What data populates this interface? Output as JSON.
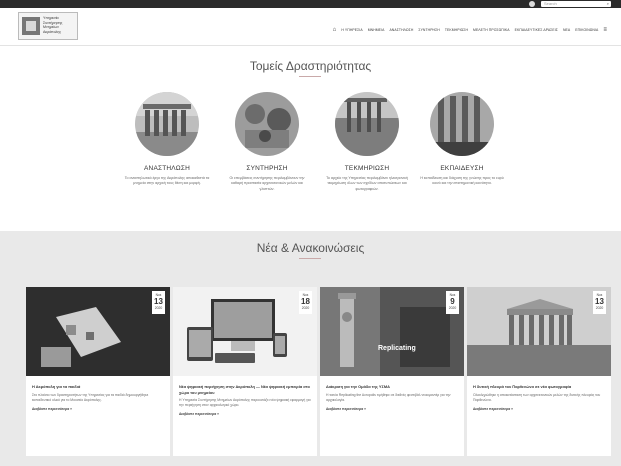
{
  "header": {
    "logo_lines": [
      "Υπηρεσία",
      "Συντήρησης",
      "Μνημείων",
      "Ακρόπολης"
    ],
    "search_placeholder": "Search",
    "nav": [
      "Η ΥΠΗΡΕΣΙΑ",
      "ΜΝΗΜΕΙΑ",
      "ΑΝΑΣΤΗΛΩΣΗ",
      "ΣΥΝΤΗΡΗΣΗ",
      "ΤΕΚΜΗΡΙΩΣΗ",
      "ΜΕΛΕΤΗ ΠΡΟΣΩΠΙΚΑ",
      "ΕΚΠΑΙΔΕΥΤΙΚΕΣ ΔΡΑΣΕΙΣ",
      "ΝΕΑ",
      "ΕΠΙΚΟΙΝΩΝΙΑ"
    ]
  },
  "activities": {
    "title": "Τομείς Δραστηριότητας",
    "items": [
      {
        "title": "ΑΝΑΣΤΗΛΩΣΗ",
        "text": "Το αναστηλωτικό έργο της Ακρόπολης αποκαθιστά τα μνημεία στην αρχική τους θέση και μορφή."
      },
      {
        "title": "ΣΥΝΤΗΡΗΣΗ",
        "text": "Οι επεμβάσεις συντήρησης περιλαμβάνουν την καθαρή προστασία αρχιτεκτονικών μελών και γλυπτών."
      },
      {
        "title": "ΤΕΚΜΗΡΙΩΣΗ",
        "text": "Το αρχείο της Υπηρεσίας περιλαμβάνει ηλεκτρονική τεκμηρίωση όλων των σχεδίων αποτυπώσεων και φωτογραφιών."
      },
      {
        "title": "ΕΚΠΑΙΔΕΥΣΗ",
        "text": "Η εκπαίδευση και διάχυση της γνώσης προς το ευρύ κοινό και την επιστημονική κοινότητα."
      }
    ]
  },
  "news": {
    "title": "Νέα & Ανακοινώσεις",
    "more_label": "Διαβάστε περισσότερα »",
    "cards": [
      {
        "date_top": "Νοε",
        "day": "13",
        "year": "2020",
        "title": "Η Ακρόπολη για τα παιδιά",
        "text": "Στο πλαίσιο των δραστηριοτήτων της Υπηρεσίας για τα παιδιά δημιουργήθηκε εκπαιδευτικό υλικό για το Μουσείο Ακρόπολης."
      },
      {
        "date_top": "Νοε",
        "day": "18",
        "year": "2020",
        "title": "Νέα ψηφιακή περιήγηση στην Ακρόπολη — Νέα ψηφιακή εμπειρία στο χώρο του μνημείου",
        "text": "Η Υπηρεσία Συντήρησης Μνημείων Ακρόπολης παρουσιάζει νέα ψηφιακή εφαρμογή για την περιήγηση στον αρχαιολογικό χώρο."
      },
      {
        "date_top": "Νοε",
        "day": "9",
        "year": "2020",
        "title": "Διάκριση για την Ομάδα της ΥΣΜΑ",
        "text": "Η ταινία Replicating the Acropolis τιμήθηκε σε διεθνές φεστιβάλ ντοκιμαντέρ για την αρχαιολογία."
      },
      {
        "date_top": "Νοε",
        "day": "13",
        "year": "2020",
        "title": "Η δυτική πλευρά του Παρθενώνα σε νέα φωτογραφία",
        "text": "Ολοκληρώθηκε η αποκατάσταση των αρχιτεκτονικών μελών της δυτικής πλευράς του Παρθενώνα."
      }
    ],
    "replicating_text": "Replicating"
  }
}
